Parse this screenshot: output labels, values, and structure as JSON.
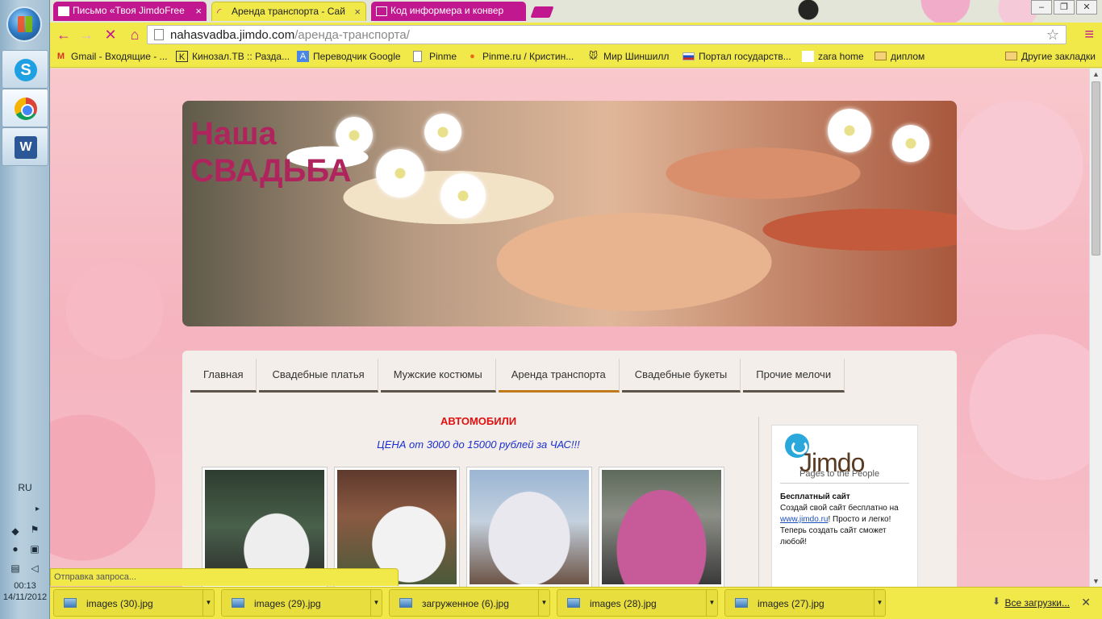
{
  "taskbar": {
    "language": "RU",
    "clock_time": "00:13",
    "clock_date": "14/11/2012"
  },
  "tabs": [
    {
      "title": "Письмо «Твоя JimdoFree",
      "active": false
    },
    {
      "title": "Аренда транспорта - Сай",
      "active": true
    },
    {
      "title": "Код информера и конвер",
      "active": false
    }
  ],
  "tab_close_glyph": "×",
  "toolbar": {
    "url_host": "nahasvadba.jimdo.com",
    "url_path": "/аренда-транспорта/"
  },
  "bookmarks": [
    {
      "label": "Gmail - Входящие - ...",
      "icon": "gmail-icon"
    },
    {
      "label": "Кинозал.ТВ :: Разда...",
      "icon": "kinozal-icon"
    },
    {
      "label": "Переводчик Google",
      "icon": "translate-icon"
    },
    {
      "label": "Pinme",
      "icon": "page-icon"
    },
    {
      "label": "Pinme.ru / Кристин...",
      "icon": "pinme-icon"
    },
    {
      "label": "Мир Шиншилл",
      "icon": "chinchilla-icon"
    },
    {
      "label": "Портал государств...",
      "icon": "russia-flag-icon"
    },
    {
      "label": "zara home",
      "icon": "blank-icon"
    },
    {
      "label": "диплом",
      "icon": "folder-icon"
    }
  ],
  "other_bookmarks": "Другие закладки",
  "site": {
    "title_line1": "Наша",
    "title_line2": "СВАДЬБА",
    "nav": [
      {
        "label": "Главная",
        "active": false
      },
      {
        "label": "Свадебные платья",
        "active": false
      },
      {
        "label": "Мужские костюмы",
        "active": false
      },
      {
        "label": "Аренда транспорта",
        "active": true
      },
      {
        "label": "Свадебные букеты",
        "active": false
      },
      {
        "label": "Прочие мелочи",
        "active": false
      }
    ],
    "heading": "АВТОМОБИЛИ",
    "price": "ЦЕНА от 3000 до 15000 рублей за ЧАС!!!"
  },
  "sidebar": {
    "logo_name": "Jimdo",
    "logo_tagline": "Pages to the People",
    "promo_title": "Бесплатный сайт",
    "promo_text_1": "Создай свой сайт бесплатно на ",
    "promo_link": "www.jimdo.ru",
    "promo_text_2": "! Просто и легко! Теперь создать сайт сможет любой!"
  },
  "status_text": "Отправка запроса...",
  "downloads": [
    {
      "name": "images (30).jpg"
    },
    {
      "name": "images (29).jpg"
    },
    {
      "name": "загруженное (6).jpg"
    },
    {
      "name": "images (28).jpg"
    },
    {
      "name": "images (27).jpg"
    }
  ],
  "all_downloads": "Все загрузки...",
  "colors": {
    "browser_theme": "#f1e94a",
    "tab_inactive": "#c2188f",
    "site_title": "#b0245e",
    "heading_red": "#e01010",
    "price_blue": "#1a2fd1"
  }
}
